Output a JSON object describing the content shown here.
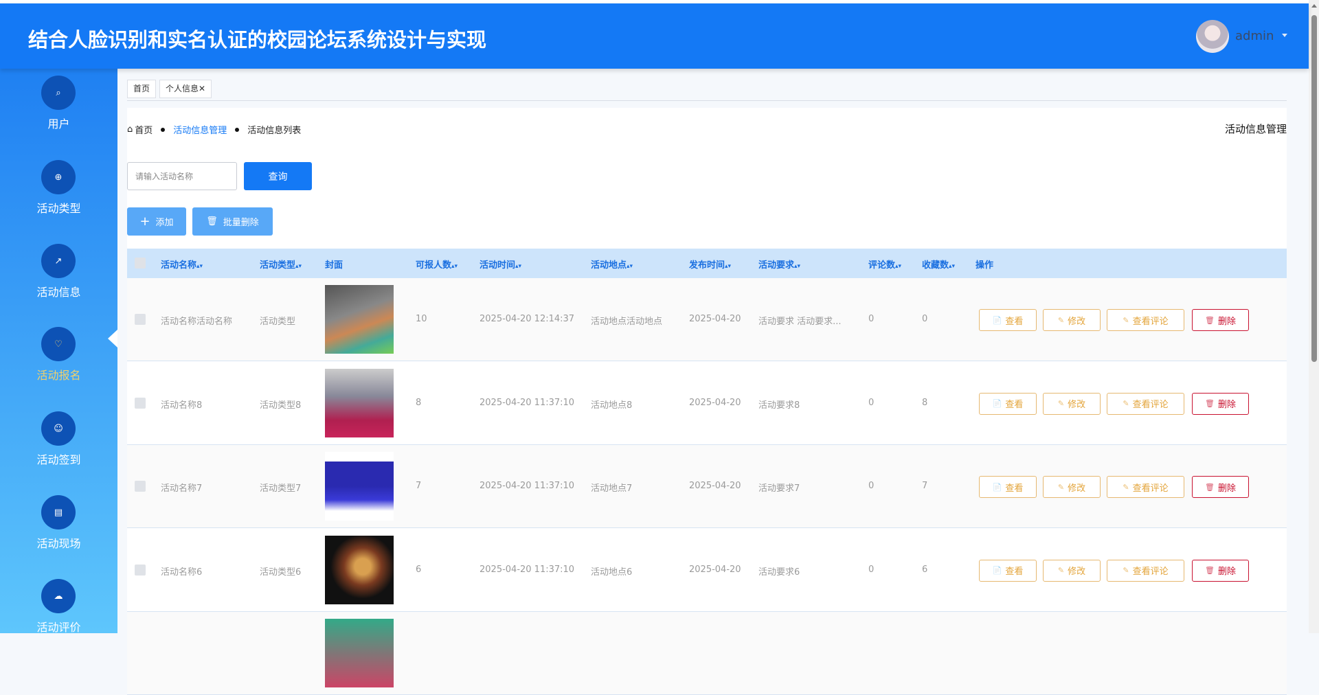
{
  "header": {
    "title": "结合人脸识别和实名认证的校园论坛系统设计与实现",
    "username": "admin"
  },
  "sidebar": {
    "items": [
      {
        "label": "用户",
        "icon": "search-icon"
      },
      {
        "label": "活动类型",
        "icon": "plus-circle-icon"
      },
      {
        "label": "活动信息",
        "icon": "chart-icon"
      },
      {
        "label": "活动报名",
        "icon": "heart-icon",
        "active": true
      },
      {
        "label": "活动签到",
        "icon": "user-check-icon"
      },
      {
        "label": "活动现场",
        "icon": "notepad-icon"
      },
      {
        "label": "活动评价",
        "icon": "comment-icon"
      }
    ]
  },
  "tabs": [
    {
      "label": "首页"
    },
    {
      "label": "个人信息"
    }
  ],
  "breadcrumb": {
    "home": "首页",
    "section": "活动信息管理",
    "current": "活动信息列表"
  },
  "page_title": "活动信息管理",
  "search": {
    "placeholder": "请输入活动名称",
    "value": "",
    "button": "查询"
  },
  "actions": {
    "add": "添加",
    "batch_delete": "批量删除"
  },
  "table": {
    "headers": [
      "活动名称",
      "活动类型",
      "封面",
      "可报人数",
      "活动时间",
      "活动地点",
      "发布时间",
      "活动要求",
      "评论数",
      "收藏数",
      "操作"
    ],
    "rows": [
      {
        "name": "活动名称活动名称",
        "type": "活动类型",
        "count": "10",
        "time": "2025-04-20 12:14:37",
        "place": "活动地点活动地点",
        "pub": "2025-04-20",
        "req": "活动要求 活动要求...",
        "comments": "0",
        "favs": "0"
      },
      {
        "name": "活动名称8",
        "type": "活动类型8",
        "count": "8",
        "time": "2025-04-20 11:37:10",
        "place": "活动地点8",
        "pub": "2025-04-20",
        "req": "活动要求8",
        "comments": "0",
        "favs": "8"
      },
      {
        "name": "活动名称7",
        "type": "活动类型7",
        "count": "7",
        "time": "2025-04-20 11:37:10",
        "place": "活动地点7",
        "pub": "2025-04-20",
        "req": "活动要求7",
        "comments": "0",
        "favs": "7"
      },
      {
        "name": "活动名称6",
        "type": "活动类型6",
        "count": "6",
        "time": "2025-04-20 11:37:10",
        "place": "活动地点6",
        "pub": "2025-04-20",
        "req": "活动要求6",
        "comments": "0",
        "favs": "6"
      }
    ],
    "ops": {
      "view": "查看",
      "edit": "修改",
      "comments": "查看评论",
      "delete": "删除"
    }
  },
  "colors": {
    "primary": "#1479f5",
    "active_menu": "#f2d16b",
    "danger": "#c8102e",
    "warning": "#e3a43a"
  }
}
